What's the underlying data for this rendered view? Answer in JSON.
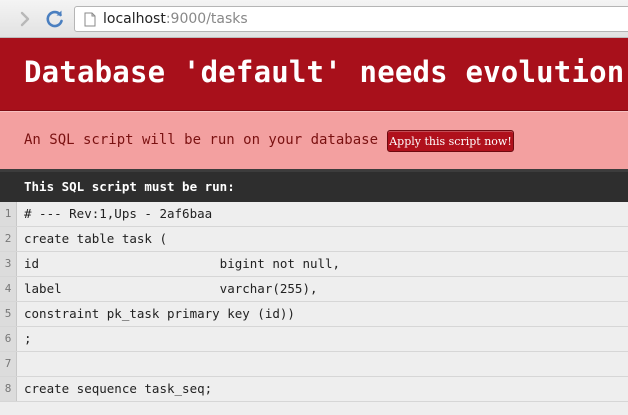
{
  "browser": {
    "url_host": "localhost",
    "url_rest": ":9000/tasks"
  },
  "banner": {
    "title": "Database 'default' needs evolution!",
    "message": "An SQL script will be run on your database -",
    "apply_button": "Apply this script now!"
  },
  "script": {
    "header": "This SQL script must be run:",
    "lines": [
      {
        "num": "1",
        "code": "# --- Rev:1,Ups - 2af6baa"
      },
      {
        "num": "2",
        "code": "create table task ("
      },
      {
        "num": "3",
        "code": "id                        bigint not null,"
      },
      {
        "num": "4",
        "code": "label                     varchar(255),"
      },
      {
        "num": "5",
        "code": "constraint pk_task primary key (id))"
      },
      {
        "num": "6",
        "code": ";"
      },
      {
        "num": "7",
        "code": ""
      },
      {
        "num": "8",
        "code": "create sequence task_seq;"
      }
    ]
  },
  "colors": {
    "banner_red": "#a8101b",
    "message_pink": "#f3a0a0",
    "header_dark": "#2e2e2e"
  }
}
